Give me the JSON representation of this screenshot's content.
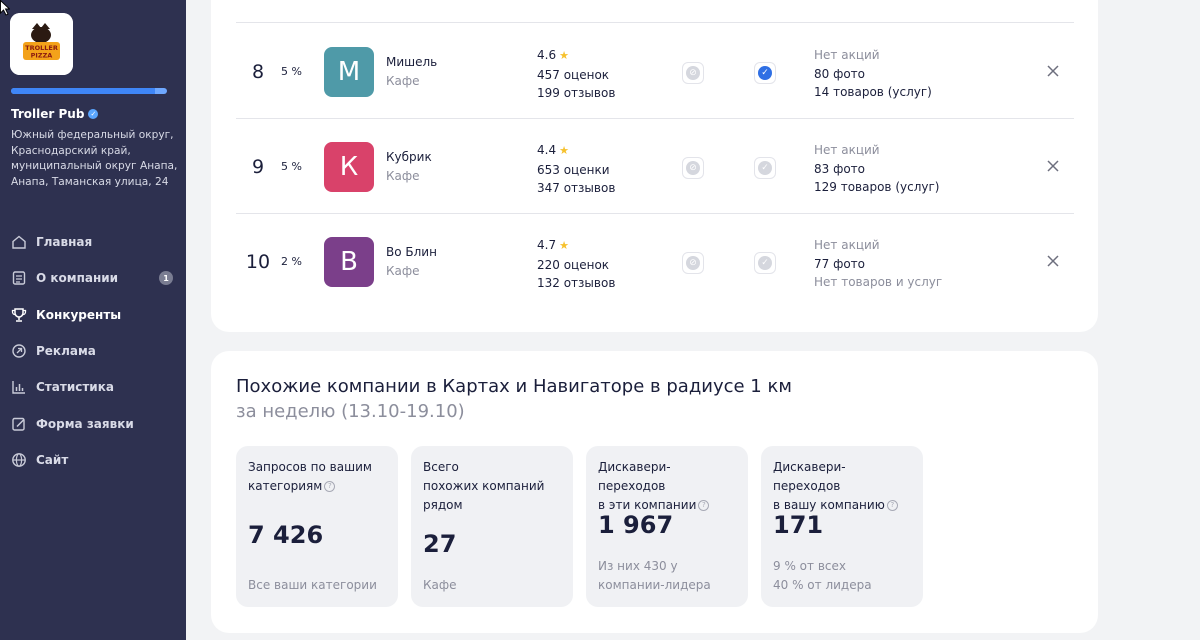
{
  "sidebar": {
    "logo_text": "TROLLER PIZZA",
    "progress": 0.92,
    "org_name": "Troller Pub",
    "address": "Южный федеральный округ, Краснодарский край, муниципальный округ Анапа, Анапа, Таманская улица, 24",
    "nav": [
      {
        "label": "Главная",
        "icon": "home-icon"
      },
      {
        "label": "О компании",
        "icon": "document-icon",
        "badge": "1"
      },
      {
        "label": "Конкуренты",
        "icon": "trophy-icon",
        "active": true
      },
      {
        "label": "Реклама",
        "icon": "ad-arrow-icon"
      },
      {
        "label": "Статистика",
        "icon": "chart-icon"
      },
      {
        "label": "Форма заявки",
        "icon": "form-edit-icon"
      },
      {
        "label": "Сайт",
        "icon": "globe-icon"
      }
    ]
  },
  "competitors": {
    "rows": [
      {
        "rank": "8",
        "percent": "5 %",
        "letter": "М",
        "color": "#4f9aa8",
        "name": "Мишель",
        "category": "Кафе",
        "rating": "4.6",
        "ratings_count": "457 оценок",
        "reviews": "199 отзывов",
        "check1": false,
        "check2": true,
        "promos": "Нет акций",
        "photos": "80 фото",
        "goods": "14 товаров (услуг)",
        "goods_muted": false
      },
      {
        "rank": "9",
        "percent": "5 %",
        "letter": "К",
        "color": "#d9426a",
        "name": "Кубрик",
        "category": "Кафе",
        "rating": "4.4",
        "ratings_count": "653 оценки",
        "reviews": "347 отзывов",
        "check1": false,
        "check2": false,
        "promos": "Нет акций",
        "photos": "83 фото",
        "goods": "129 товаров (услуг)",
        "goods_muted": false
      },
      {
        "rank": "10",
        "percent": "2 %",
        "letter": "В",
        "color": "#7b3f8a",
        "name": "Во Блин",
        "category": "Кафе",
        "rating": "4.7",
        "ratings_count": "220 оценок",
        "reviews": "132 отзывов",
        "check1": false,
        "check2": false,
        "promos": "Нет акций",
        "photos": "77 фото",
        "goods": "Нет товаров и услуг",
        "goods_muted": true
      }
    ]
  },
  "similar": {
    "title": "Похожие компании в Картах и Навигаторе в радиусе 1 км",
    "period": "за неделю (13.10-19.10)",
    "stats": [
      {
        "label_lines": [
          "Запросов по вашим",
          "категориям"
        ],
        "help": true,
        "value": "7 426",
        "note_lines": [
          "Все ваши категории"
        ]
      },
      {
        "label_lines": [
          "Всего",
          "похожих компаний",
          "рядом"
        ],
        "help": false,
        "value": "27",
        "note_lines": [
          "Кафе"
        ]
      },
      {
        "label_lines": [
          "Дискавери-переходов",
          "в эти компании"
        ],
        "help": true,
        "value": "1 967",
        "note_lines": [
          "Из них 430 у",
          "компании-лидера"
        ]
      },
      {
        "label_lines": [
          "Дискавери-переходов",
          "в вашу компанию"
        ],
        "help": true,
        "value": "171",
        "note_lines": [
          "9 % от всех",
          "40 % от лидера"
        ]
      }
    ]
  }
}
